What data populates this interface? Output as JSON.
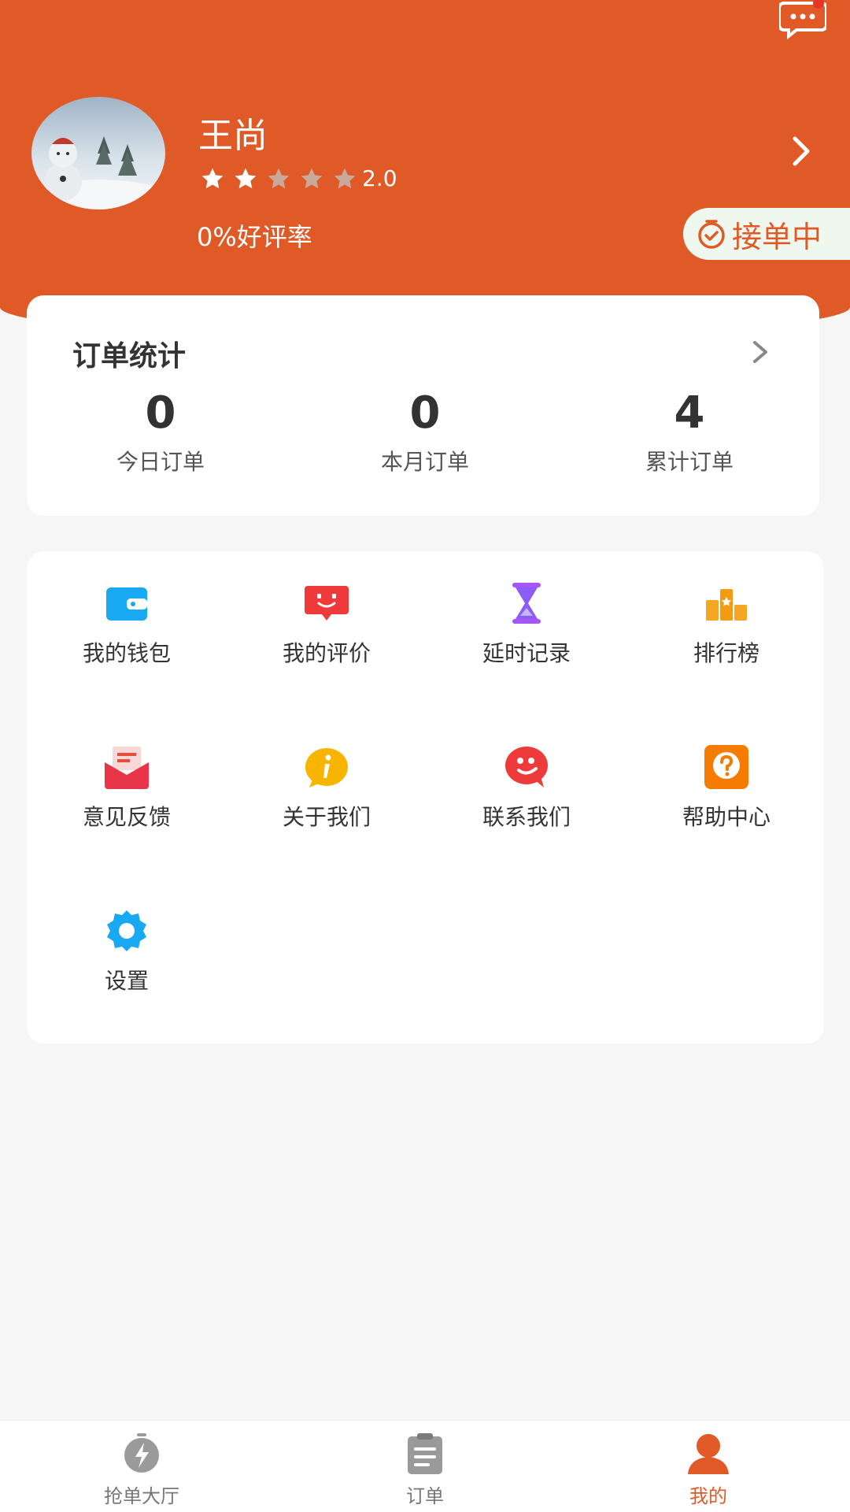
{
  "colors": {
    "brand": "#e05a28",
    "status_bg": "#eef8ef",
    "page_bg": "#f6f6f6"
  },
  "profile": {
    "name": "王尚",
    "rating": 2.0,
    "rating_text": "2.0",
    "stars_filled": 2,
    "stars_total": 5,
    "good_rate": "0%好评率",
    "status": "接单中"
  },
  "stats": {
    "title": "订单统计",
    "items": [
      {
        "value": "0",
        "label": "今日订单"
      },
      {
        "value": "0",
        "label": "本月订单"
      },
      {
        "value": "4",
        "label": "累计订单"
      }
    ]
  },
  "menu": {
    "items": [
      {
        "label": "我的钱包",
        "icon": "wallet-icon"
      },
      {
        "label": "我的评价",
        "icon": "review-icon"
      },
      {
        "label": "延时记录",
        "icon": "hourglass-icon"
      },
      {
        "label": "排行榜",
        "icon": "ranking-icon"
      },
      {
        "label": "意见反馈",
        "icon": "feedback-icon"
      },
      {
        "label": "关于我们",
        "icon": "info-icon"
      },
      {
        "label": "联系我们",
        "icon": "contact-icon"
      },
      {
        "label": "帮助中心",
        "icon": "help-icon"
      },
      {
        "label": "设置",
        "icon": "settings-icon"
      }
    ]
  },
  "tabbar": {
    "items": [
      {
        "label": "抢单大厅",
        "icon": "grab-order-icon",
        "active": false
      },
      {
        "label": "订单",
        "icon": "orders-icon",
        "active": false
      },
      {
        "label": "我的",
        "icon": "profile-icon",
        "active": true
      }
    ]
  }
}
